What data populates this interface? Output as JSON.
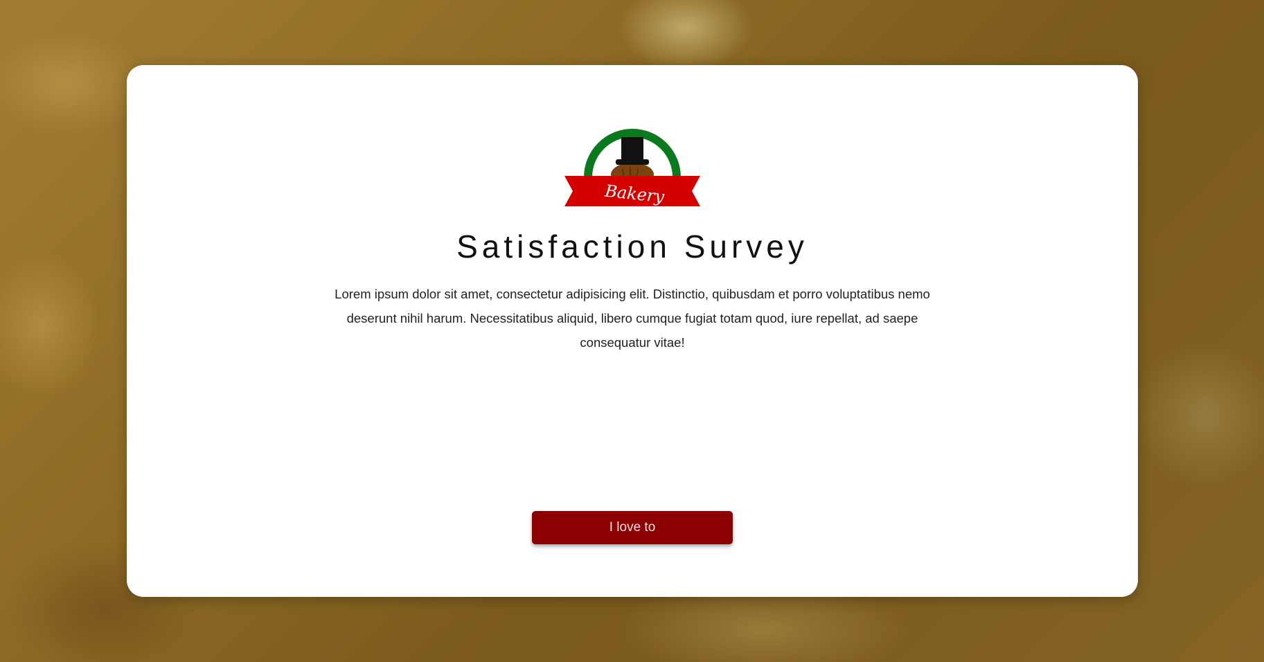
{
  "logo": {
    "text": "Bakery",
    "colors": {
      "arch": "#0b7a1e",
      "hat": "#111111",
      "bun": "#7a4412",
      "ribbon": "#d40000",
      "ribbon_text": "#ffffff"
    }
  },
  "survey": {
    "title": "Satisfaction Survey",
    "description": "Lorem ipsum dolor sit amet, consectetur adipisicing elit. Distinctio, quibusdam et porro voluptatibus nemo deserunt nihil harum. Necessitatibus aliquid, libero cumque fugiat totam quod, iure repellat, ad saepe consequatur vitae!",
    "button_label": "I love to",
    "button_color": "#8b0000"
  }
}
